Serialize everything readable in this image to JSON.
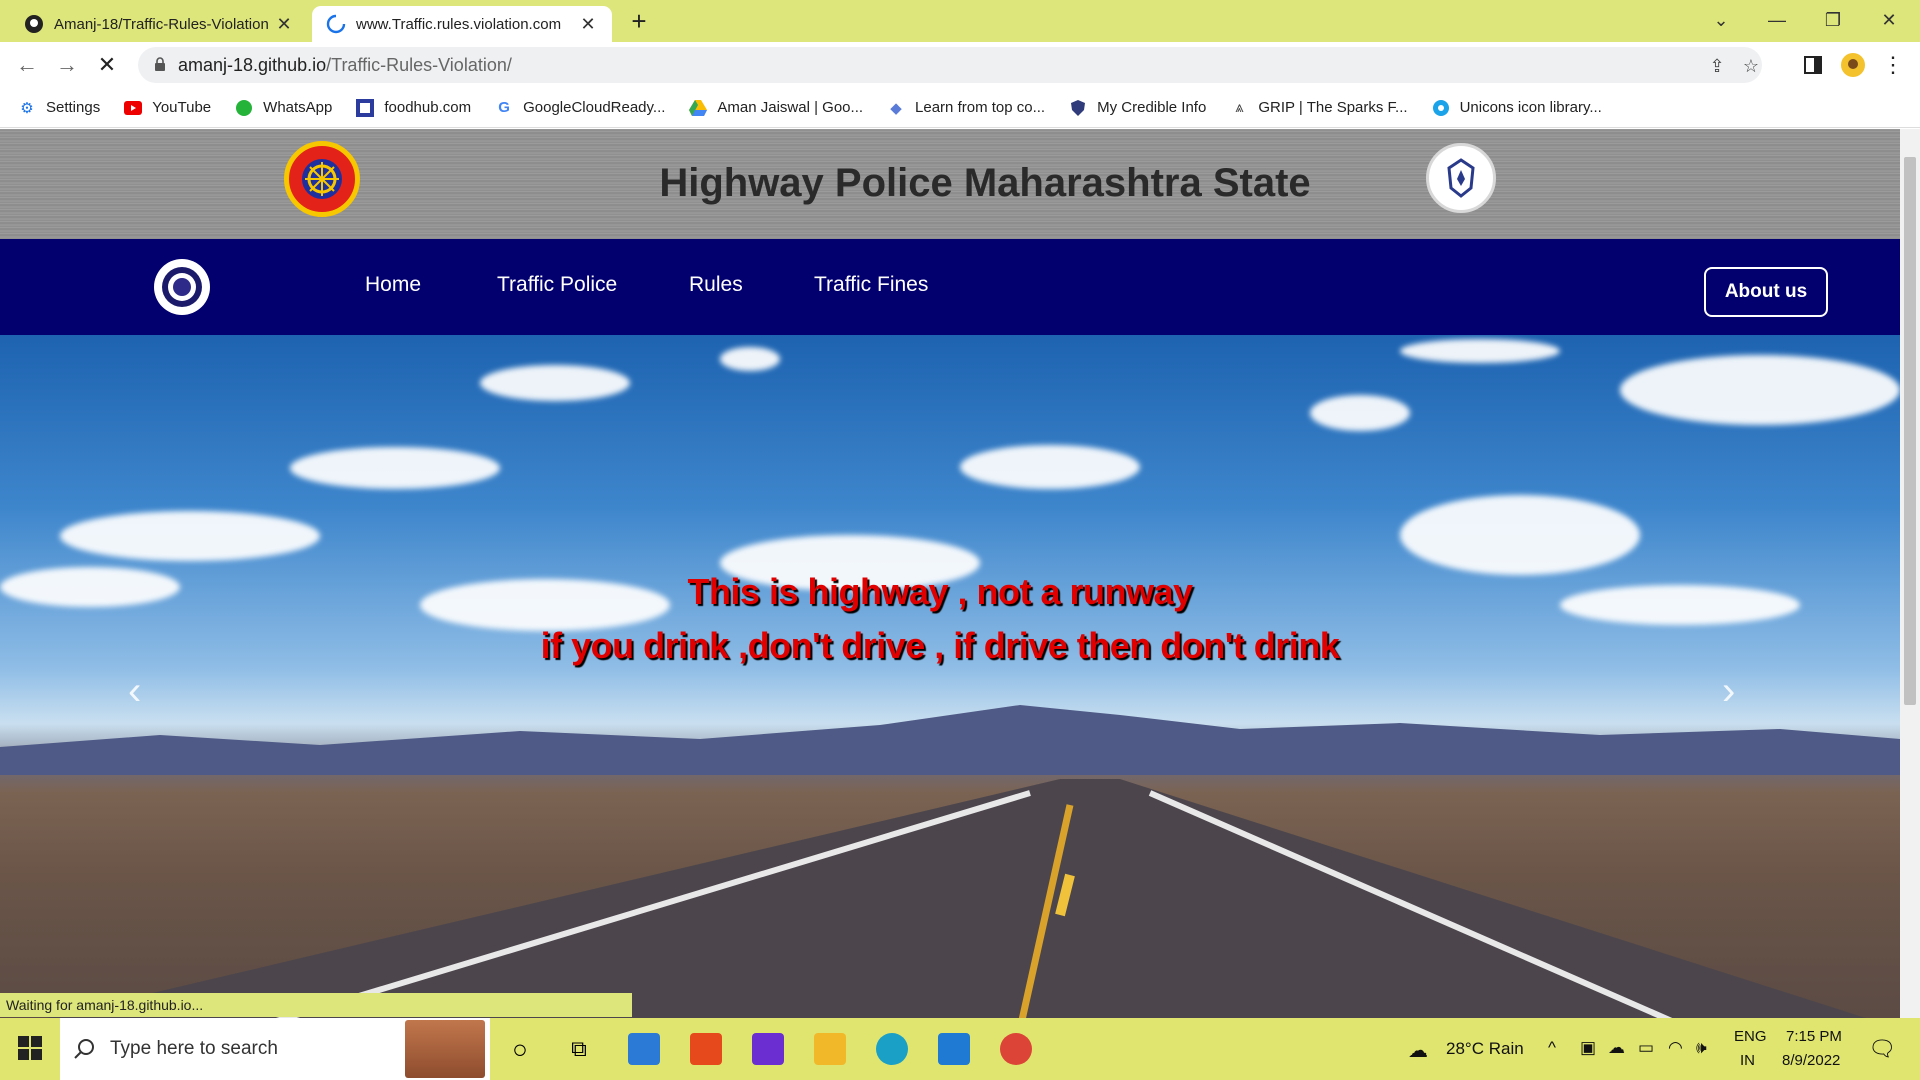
{
  "browser": {
    "tabs": [
      {
        "title": "Amanj-18/Traffic-Rules-Violation",
        "active": false
      },
      {
        "title": "www.Traffic.rules.violation.com",
        "active": true
      }
    ],
    "url_host": "amanj-18.github.io",
    "url_path": "/Traffic-Rules-Violation/",
    "bookmarks": [
      {
        "label": "Settings",
        "icon": "gear-icon"
      },
      {
        "label": "YouTube",
        "icon": "youtube-icon"
      },
      {
        "label": "WhatsApp",
        "icon": "whatsapp-icon"
      },
      {
        "label": "foodhub.com",
        "icon": "foodhub-icon"
      },
      {
        "label": "GoogleCloudReady...",
        "icon": "google-icon"
      },
      {
        "label": "Aman Jaiswal | Goo...",
        "icon": "drive-icon"
      },
      {
        "label": "Learn from top co...",
        "icon": "diamond-icon"
      },
      {
        "label": "My Credible Info",
        "icon": "shield-icon"
      },
      {
        "label": "GRIP | The Sparks F...",
        "icon": "grip-icon"
      },
      {
        "label": "Unicons icon library...",
        "icon": "unicons-icon"
      }
    ],
    "status_text": "Waiting for amanj-18.github.io..."
  },
  "page": {
    "header_title": "Highway Police Maharashtra State",
    "nav": {
      "links": [
        "Home",
        "Traffic Police",
        "Rules",
        "Traffic Fines"
      ],
      "about_button": "About us"
    },
    "hero": {
      "line1": "This is highway , not a runway",
      "line2": "if you drink ,don't drive , if drive then don't drink"
    }
  },
  "taskbar": {
    "search_placeholder": "Type here to search",
    "weather": "28°C  Rain",
    "lang_top": "ENG",
    "lang_bottom": "IN",
    "time": "7:15 PM",
    "date": "8/9/2022"
  },
  "colors": {
    "tab_strip": "#dde67a",
    "navbar": "#02006e",
    "hero_text": "#e00000"
  }
}
